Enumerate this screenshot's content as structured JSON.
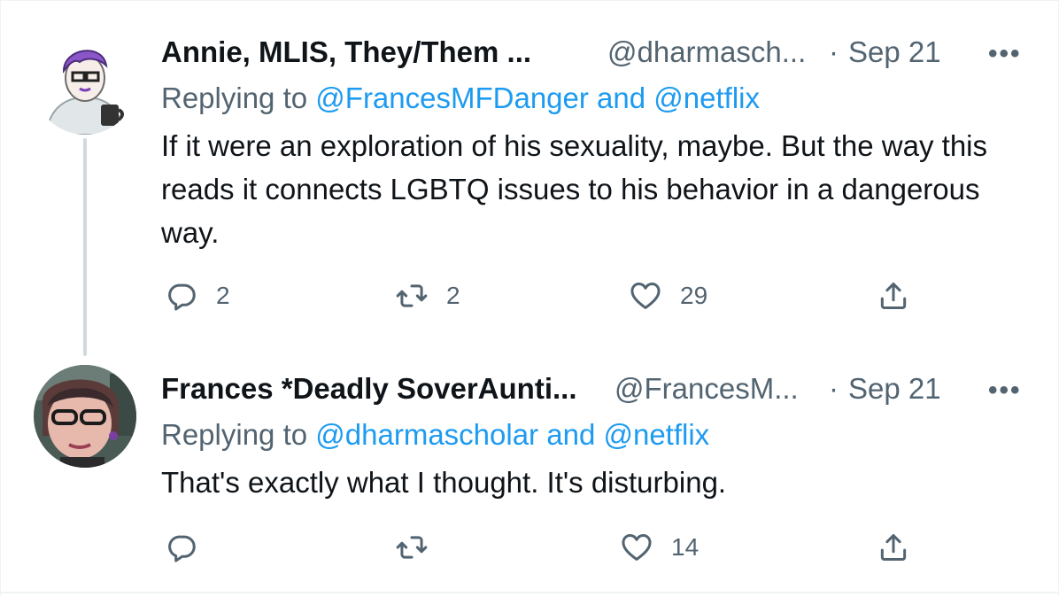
{
  "tweets": [
    {
      "name": "Annie, MLIS, They/Them ...",
      "handle": "@dharmasch...",
      "dot": "·",
      "date": "Sep 21",
      "more": "•••",
      "replying_prefix": "Replying to",
      "mention_1": "@FrancesMFDanger",
      "and": "and",
      "mention_2": "@netflix",
      "text": "If it were an exploration of his sexuality, maybe. But the way this reads it connects LGBTQ issues to his behavior in a dangerous way.",
      "replies": "2",
      "retweets": "2",
      "likes": "29"
    },
    {
      "name": "Frances *Deadly SoverAunti...",
      "handle": "@FrancesM...",
      "dot": "·",
      "date": "Sep 21",
      "more": "•••",
      "replying_prefix": "Replying to",
      "mention_1": "@dharmascholar",
      "and": "and",
      "mention_2": "@netflix",
      "text": "That's exactly what I thought. It's disturbing.",
      "replies": "",
      "retweets": "",
      "likes": "14"
    }
  ],
  "colors": {
    "text": "#0f1419",
    "secondary": "#536471",
    "link": "#1d9bf0",
    "thread_line": "#cfd9de"
  },
  "icons": [
    "reply-icon",
    "retweet-icon",
    "like-icon",
    "share-icon",
    "more-icon"
  ]
}
